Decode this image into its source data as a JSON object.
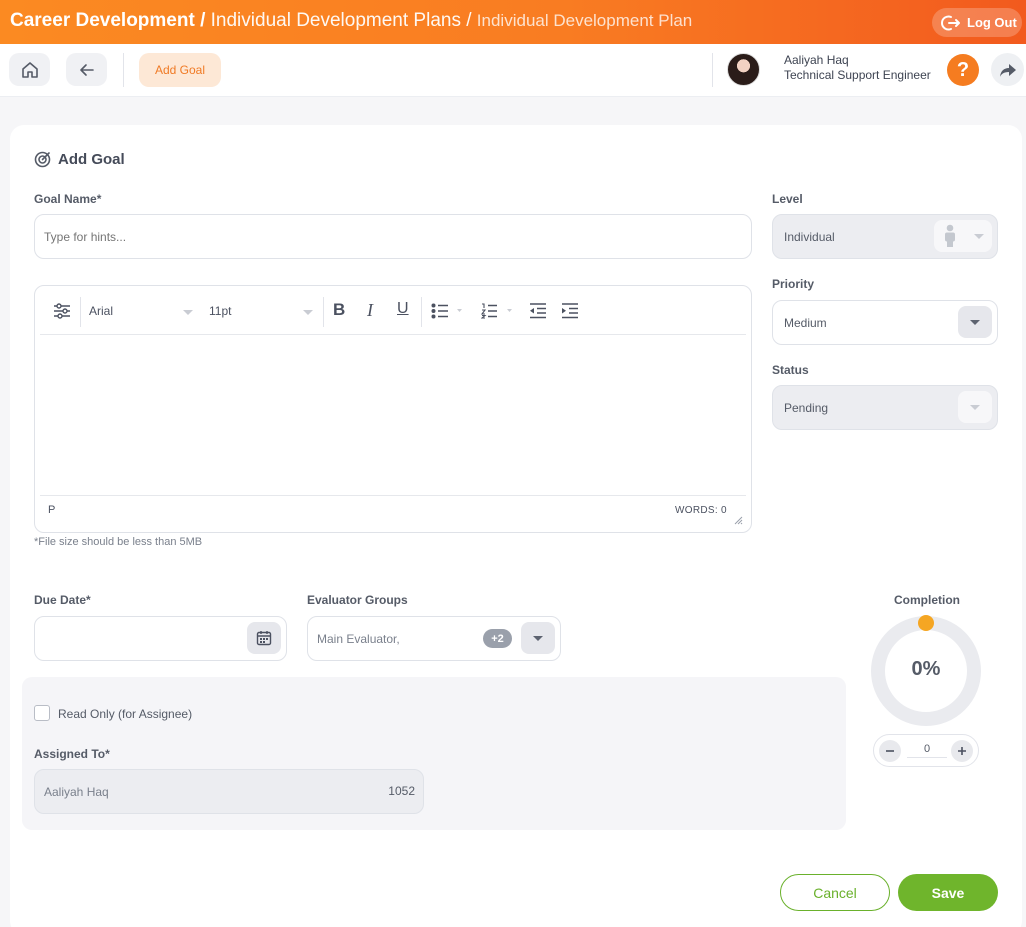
{
  "breadcrumb": {
    "section": "Career Development /",
    "parent": "Individual Development Plans /",
    "current": "Individual Development Plan"
  },
  "header": {
    "logout_label": "Log Out"
  },
  "toolbar": {
    "active_chip": "Add Goal"
  },
  "user": {
    "name": "Aaliyah Haq",
    "role": "Technical Support Engineer"
  },
  "form": {
    "title": "Add Goal",
    "goal_name_label": "Goal Name*",
    "goal_name_placeholder": "Type for hints...",
    "level": {
      "label": "Level",
      "value": "Individual"
    },
    "priority": {
      "label": "Priority",
      "value": "Medium"
    },
    "status": {
      "label": "Status",
      "value": "Pending"
    },
    "editor": {
      "font": "Arial",
      "size": "11pt",
      "path": "P",
      "word_count": "WORDS: 0",
      "file_note": "*File size should be less than 5MB"
    },
    "due_date_label": "Due Date*",
    "evaluator": {
      "label": "Evaluator Groups",
      "value": "Main Evaluator,",
      "extra_count": "+2"
    },
    "read_only_label": "Read Only (for Assignee)",
    "assigned": {
      "label": "Assigned To*",
      "name": "Aaliyah Haq",
      "id": "1052"
    },
    "completion": {
      "label": "Completion",
      "percent_text": "0%",
      "value": "0",
      "fraction": 0
    },
    "cancel_label": "Cancel",
    "save_label": "Save"
  },
  "colors": {
    "brand_orange": "#f97c22",
    "accent_green": "#6fb52c",
    "dot_orange": "#f5a623"
  }
}
